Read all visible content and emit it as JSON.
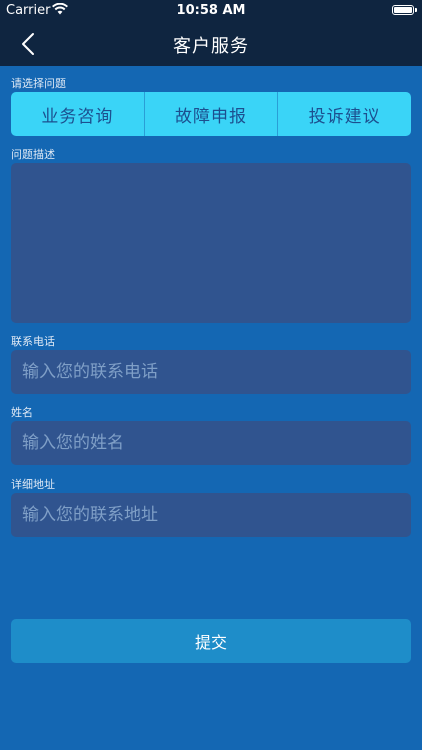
{
  "status_bar": {
    "carrier": "Carrier",
    "time": "10:58 AM",
    "wifi_icon": "wifi-icon",
    "battery_icon": "battery-icon"
  },
  "nav": {
    "title": "客户服务",
    "back_icon": "chevron-left-icon"
  },
  "problem": {
    "label": "请选择问题",
    "options": [
      "业务咨询",
      "故障申报",
      "投诉建议"
    ]
  },
  "description": {
    "label": "问题描述",
    "value": "",
    "placeholder": ""
  },
  "phone": {
    "label": "联系电话",
    "value": "",
    "placeholder": "输入您的联系电话"
  },
  "name": {
    "label": "姓名",
    "value": "",
    "placeholder": "输入您的姓名"
  },
  "address": {
    "label": "详细地址",
    "value": "",
    "placeholder": "输入您的联系地址"
  },
  "submit": {
    "label": "提交"
  },
  "colors": {
    "background": "#1467b3",
    "nav_background": "#0f2540",
    "segment": "#3ad4f7",
    "segment_text": "#1c4f8f",
    "field": "#30548f",
    "button": "#1e8dc9"
  }
}
